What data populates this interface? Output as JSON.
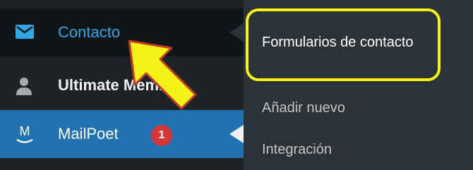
{
  "sidebar": {
    "items": [
      {
        "label": "Contacto",
        "icon": "envelope-icon"
      },
      {
        "label": "Ultimate Member",
        "icon": "user-icon"
      },
      {
        "label": "MailPoet",
        "icon": "mailpoet-icon",
        "badge": "1"
      }
    ]
  },
  "submenu": {
    "items": [
      {
        "label": "Formularios de contacto"
      },
      {
        "label": "Añadir nuevo"
      },
      {
        "label": "Integración"
      }
    ]
  },
  "colors": {
    "highlight": "#f5f215",
    "arrow": "#f5f215",
    "arrow_outline": "#c0392b",
    "active_menu": "#2271b1"
  }
}
